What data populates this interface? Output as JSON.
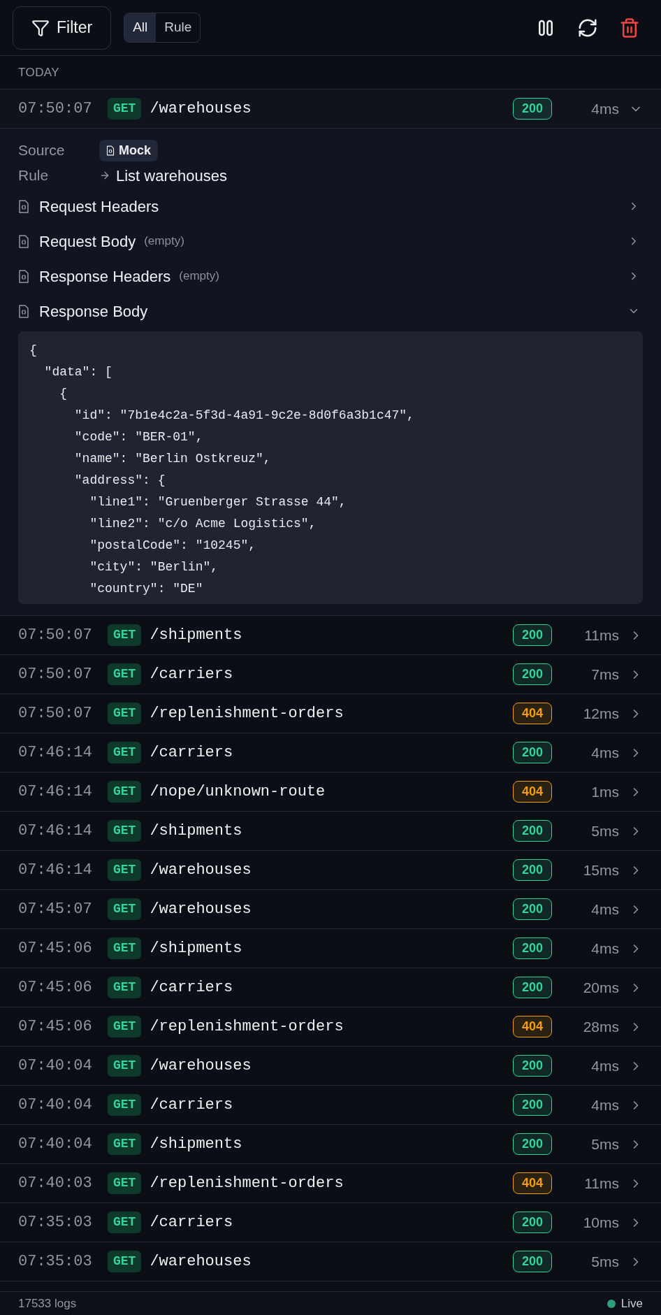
{
  "toolbar": {
    "filter_button": "Filter",
    "segments": [
      {
        "label": "All",
        "selected": true
      },
      {
        "label": "Rule",
        "selected": false
      }
    ],
    "paused": false
  },
  "group_label": "TODAY",
  "logs": [
    {
      "time": "07:50:07",
      "method": "GET",
      "path": "/warehouses",
      "status": {
        "code": "200",
        "color": "#34d399"
      },
      "duration": "4ms",
      "expanded": true,
      "detail": {
        "source_label": "Source",
        "source": "Mock",
        "rule_label": "Rule",
        "rule": "List warehouses",
        "sections": [
          {
            "title": "Request Headers",
            "expanded": false
          },
          {
            "title": "Request Body",
            "note": "(empty)",
            "expanded": false
          },
          {
            "title": "Response Headers",
            "note": "(empty)",
            "expanded": false
          },
          {
            "title": "Response Body",
            "expanded": true,
            "code": [
              "{",
              "  \"data\": [",
              "    {",
              "      \"id\": \"7b1e4c2a-5f3d-4a91-9c2e-8d0f6a3b1c47\",",
              "      \"code\": \"BER-01\",",
              "      \"name\": \"Berlin Ostkreuz\",",
              "      \"address\": {",
              "        \"line1\": \"Gruenberger Strasse 44\",",
              "        \"line2\": \"c/o Acme Logistics\",",
              "        \"postalCode\": \"10245\",",
              "        \"city\": \"Berlin\",",
              "        \"country\": \"DE\""
            ]
          }
        ]
      }
    },
    {
      "time": "07:50:07",
      "method": "GET",
      "path": "/shipments",
      "status": {
        "code": "200",
        "color": "#34d399"
      },
      "duration": "11ms",
      "expanded": false
    },
    {
      "time": "07:50:07",
      "method": "GET",
      "path": "/carriers",
      "status": {
        "code": "200",
        "color": "#34d399"
      },
      "duration": "7ms",
      "expanded": false
    },
    {
      "time": "07:50:07",
      "method": "GET",
      "path": "/replenishment-orders",
      "status": {
        "code": "404",
        "color": "#f59e0b"
      },
      "duration": "12ms",
      "expanded": false
    },
    {
      "time": "07:46:14",
      "method": "GET",
      "path": "/carriers",
      "status": {
        "code": "200",
        "color": "#34d399"
      },
      "duration": "4ms",
      "expanded": false
    },
    {
      "time": "07:46:14",
      "method": "GET",
      "path": "/nope/unknown-route",
      "status": {
        "code": "404",
        "color": "#f59e0b"
      },
      "duration": "1ms",
      "expanded": false
    },
    {
      "time": "07:46:14",
      "method": "GET",
      "path": "/shipments",
      "status": {
        "code": "200",
        "color": "#34d399"
      },
      "duration": "5ms",
      "expanded": false
    },
    {
      "time": "07:46:14",
      "method": "GET",
      "path": "/warehouses",
      "status": {
        "code": "200",
        "color": "#34d399"
      },
      "duration": "15ms",
      "expanded": false
    },
    {
      "time": "07:45:07",
      "method": "GET",
      "path": "/warehouses",
      "status": {
        "code": "200",
        "color": "#34d399"
      },
      "duration": "4ms",
      "expanded": false
    },
    {
      "time": "07:45:06",
      "method": "GET",
      "path": "/shipments",
      "status": {
        "code": "200",
        "color": "#34d399"
      },
      "duration": "4ms",
      "expanded": false
    },
    {
      "time": "07:45:06",
      "method": "GET",
      "path": "/carriers",
      "status": {
        "code": "200",
        "color": "#34d399"
      },
      "duration": "20ms",
      "expanded": false
    },
    {
      "time": "07:45:06",
      "method": "GET",
      "path": "/replenishment-orders",
      "status": {
        "code": "404",
        "color": "#f59e0b"
      },
      "duration": "28ms",
      "expanded": false
    },
    {
      "time": "07:40:04",
      "method": "GET",
      "path": "/warehouses",
      "status": {
        "code": "200",
        "color": "#34d399"
      },
      "duration": "4ms",
      "expanded": false
    },
    {
      "time": "07:40:04",
      "method": "GET",
      "path": "/carriers",
      "status": {
        "code": "200",
        "color": "#34d399"
      },
      "duration": "4ms",
      "expanded": false
    },
    {
      "time": "07:40:04",
      "method": "GET",
      "path": "/shipments",
      "status": {
        "code": "200",
        "color": "#34d399"
      },
      "duration": "5ms",
      "expanded": false
    },
    {
      "time": "07:40:03",
      "method": "GET",
      "path": "/replenishment-orders",
      "status": {
        "code": "404",
        "color": "#f59e0b"
      },
      "duration": "11ms",
      "expanded": false
    },
    {
      "time": "07:35:03",
      "method": "GET",
      "path": "/carriers",
      "status": {
        "code": "200",
        "color": "#34d399"
      },
      "duration": "10ms",
      "expanded": false
    },
    {
      "time": "07:35:03",
      "method": "GET",
      "path": "/warehouses",
      "status": {
        "code": "200",
        "color": "#34d399"
      },
      "duration": "5ms",
      "expanded": false
    }
  ],
  "status_bar": {
    "count": "17533 logs",
    "live_label": "Live",
    "live": true
  }
}
